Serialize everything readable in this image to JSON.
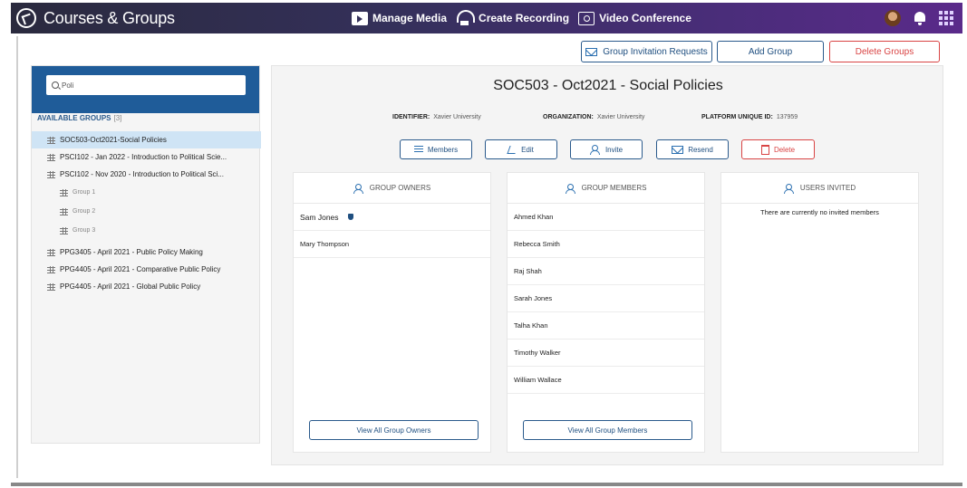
{
  "app": {
    "title": "Courses & Groups"
  },
  "topnav": {
    "manage_media": "Manage Media",
    "create_recording": "Create Recording",
    "video_conference": "Video Conference"
  },
  "toolbar": {
    "invitation_requests": "Group Invitation Requests",
    "add_group": "Add Group",
    "delete_groups": "Delete Groups"
  },
  "sidebar": {
    "search_value": "Poli",
    "available_label": "AVAILABLE GROUPS",
    "available_count": "[3]",
    "groups": [
      {
        "label": "SOC503-Oct2021-Social Policies"
      },
      {
        "label": "PSCI102 - Jan 2022 - Introduction to Political Scie..."
      },
      {
        "label": "PSCI102 - Nov 2020 - Introduction to Political Sci..."
      },
      {
        "label": "Group 1"
      },
      {
        "label": "Group 2"
      },
      {
        "label": "Group 3"
      },
      {
        "label": "PPG3405 - April 2021 - Public Policy Making"
      },
      {
        "label": "PPG4405 - April 2021 - Comparative Public Policy"
      },
      {
        "label": "PPG4405 - April 2021 - Global Public Policy"
      }
    ]
  },
  "detail": {
    "title": "SOC503 - Oct2021 - Social Policies",
    "identifier_label": "IDENTIFIER:",
    "identifier_value": "Xavier University",
    "organization_label": "ORGANIZATION:",
    "organization_value": "Xavier University",
    "platform_label": "PLATFORM UNIQUE ID:",
    "platform_value": "137959",
    "actions": {
      "members": "Members",
      "edit": "Edit",
      "invite": "Invite",
      "resend": "Resend",
      "delete": "Delete"
    },
    "owners": {
      "header": "GROUP OWNERS",
      "items": [
        "Sam Jones",
        "Mary Thompson"
      ],
      "view_all": "View All Group Owners"
    },
    "members": {
      "header": "GROUP MEMBERS",
      "items": [
        "Ahmed Khan",
        "Rebecca Smith",
        "Raj Shah",
        "Sarah Jones",
        "Talha Khan",
        "Timothy Walker",
        "William Wallace"
      ],
      "view_all": "View All Group Members"
    },
    "invited": {
      "header": "USERS INVITED",
      "empty": "There are currently no invited members"
    }
  },
  "colors": {
    "topbar_start": "#2a2a3e",
    "topbar_end": "#5a2a8a",
    "accent": "#1f5c99",
    "danger": "#d94444",
    "selected": "#cfe4f5"
  }
}
